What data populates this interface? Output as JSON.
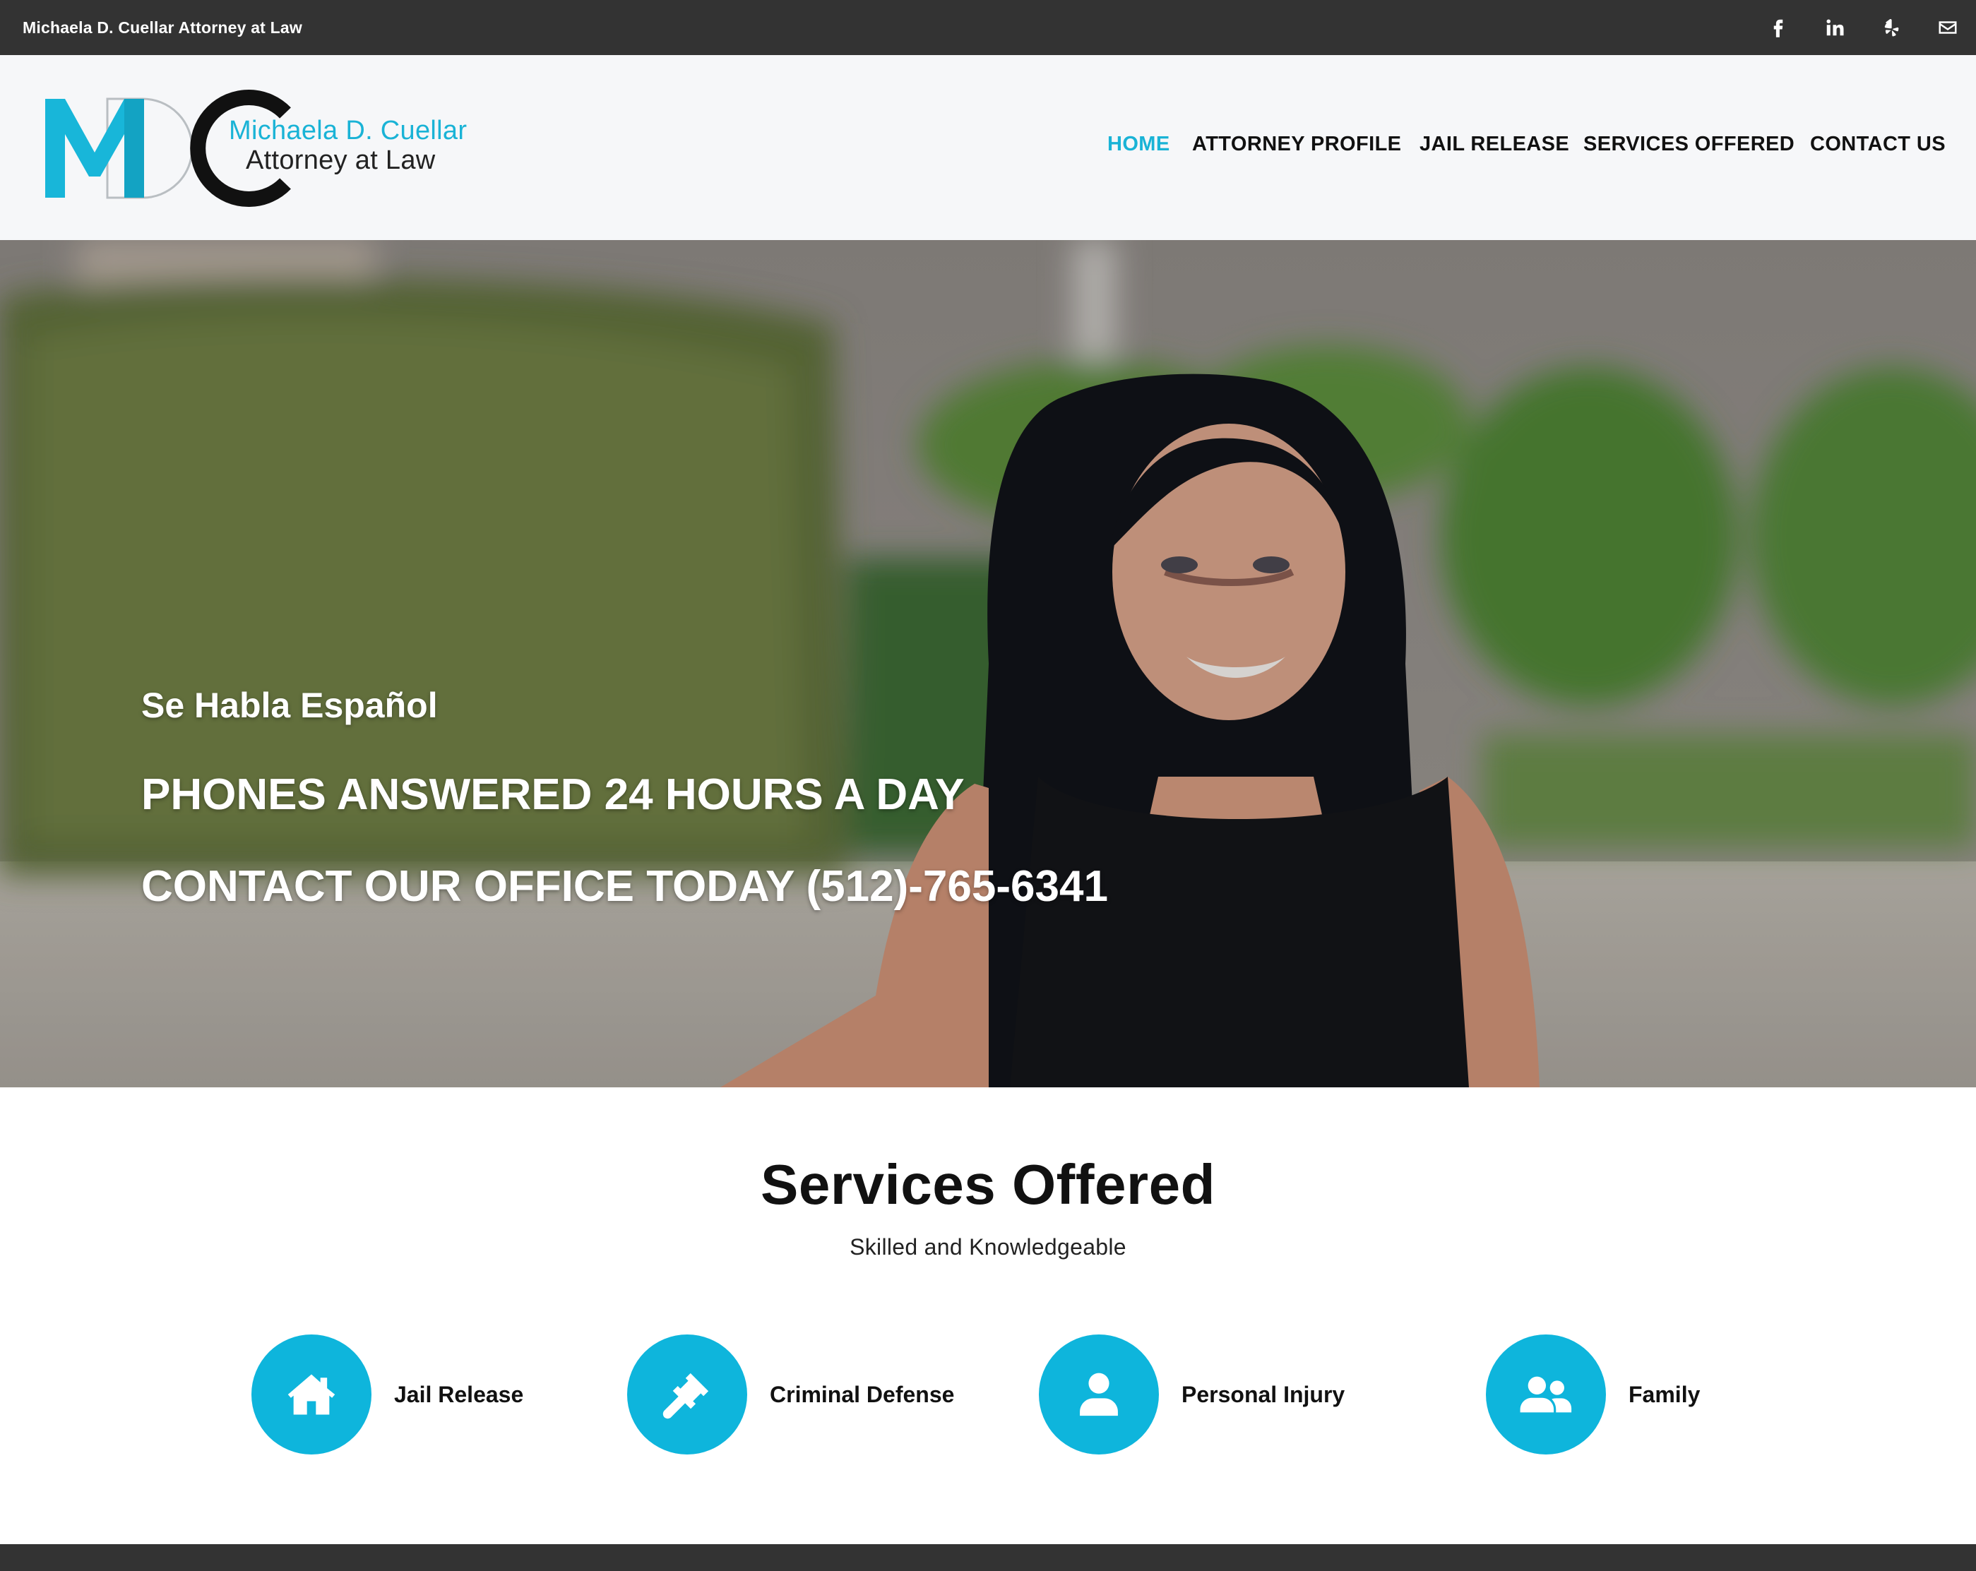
{
  "topbar": {
    "title": "Michaela D. Cuellar Attorney at Law",
    "social": [
      {
        "icon": "facebook-icon"
      },
      {
        "icon": "linkedin-icon"
      },
      {
        "icon": "yelp-icon"
      },
      {
        "icon": "email-icon"
      }
    ]
  },
  "logo": {
    "monogram": "MDC",
    "name": "Michaela D. Cuellar",
    "subtitle": "Attorney at Law"
  },
  "nav": {
    "items": [
      {
        "label": "HOME",
        "active": true
      },
      {
        "label": "ATTORNEY PROFILE",
        "active": false
      },
      {
        "label": "JAIL RELEASE",
        "active": false
      },
      {
        "label": "SERVICES OFFERED",
        "active": false
      },
      {
        "label": "CONTACT US",
        "active": false
      }
    ]
  },
  "hero": {
    "line1": "Se Habla Español",
    "line2": "PHONES ANSWERED 24 HOURS A DAY",
    "line3": "CONTACT OUR OFFICE TODAY (512)-765-6341"
  },
  "services": {
    "title": "Services Offered",
    "subtitle": "Skilled and Knowledgeable",
    "items": [
      {
        "label": "Jail Release",
        "icon": "home-icon"
      },
      {
        "label": "Criminal Defense",
        "icon": "gavel-icon"
      },
      {
        "label": "Personal Injury",
        "icon": "user-icon"
      },
      {
        "label": "Family",
        "icon": "users-icon"
      }
    ]
  },
  "colors": {
    "accent": "#1ab3d6",
    "circle": "#0eb5dc",
    "topbar": "#333333",
    "header_bg": "#f6f7f9"
  }
}
